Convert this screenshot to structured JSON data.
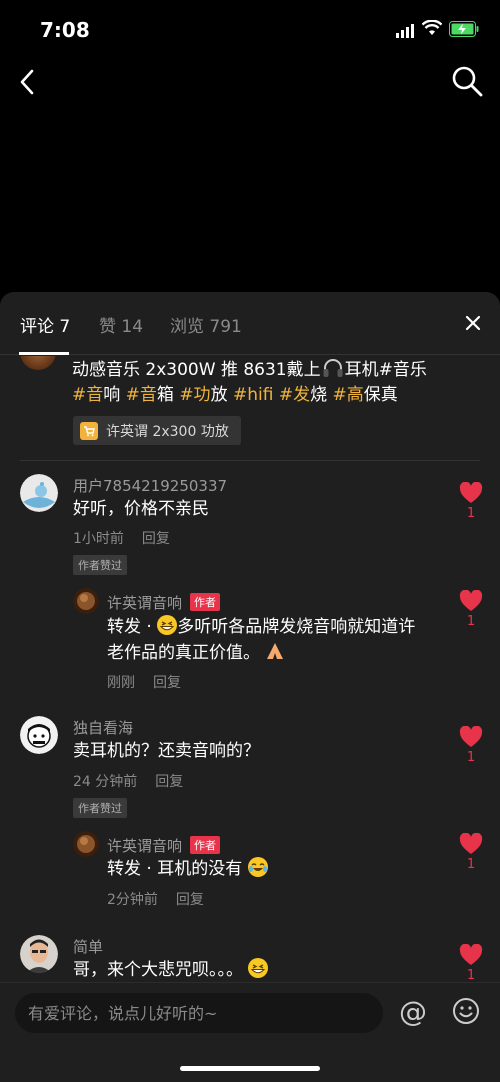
{
  "status": {
    "time": "7:08"
  },
  "tabs": [
    {
      "label": "评论 7"
    },
    {
      "label": "赞 14"
    },
    {
      "label": "浏览 791"
    }
  ],
  "post": {
    "line1": "动感音乐 2x300W 推 8631戴上",
    "line1b": "耳机#音乐",
    "hashtags": [
      "#音",
      "响",
      "#音",
      "箱",
      "#功",
      "放",
      "#hifi",
      "#发",
      "烧",
      "#高",
      "保真"
    ],
    "product": "许英谓 2x300 功放"
  },
  "comments": [
    {
      "user": "用户7854219250337",
      "text": "好听，价格不亲民",
      "time": "1小时前",
      "reply": "回复",
      "liked_tag": "作者赞过",
      "likes": "1",
      "sub": {
        "user": "许英谓音响",
        "tag": "作者",
        "text_a": "转发 ·",
        "text_b": "多听听各品牌发烧音响就知道许",
        "text_c": "老作品的真正价值。",
        "time": "刚刚",
        "reply": "回复",
        "likes": "1"
      }
    },
    {
      "user": "独自看海",
      "text": "卖耳机的？还卖音响的？",
      "time": "24 分钟前",
      "reply": "回复",
      "liked_tag": "作者赞过",
      "likes": "1",
      "sub": {
        "user": "许英谓音响",
        "tag": "作者",
        "text_a": "转发 · 耳机的没有",
        "time": "2分钟前",
        "reply": "回复",
        "likes": "1"
      }
    },
    {
      "user": "简单",
      "text": "哥，来个大悲咒呗。。。",
      "likes": "1"
    }
  ],
  "input": {
    "placeholder": "有爱评论，说点儿好听的~"
  },
  "icons": {
    "at": "@"
  },
  "colors": {
    "accent_red": "#e8344a",
    "hashtag": "#f0b43a",
    "panel": "#1f1f1f"
  }
}
